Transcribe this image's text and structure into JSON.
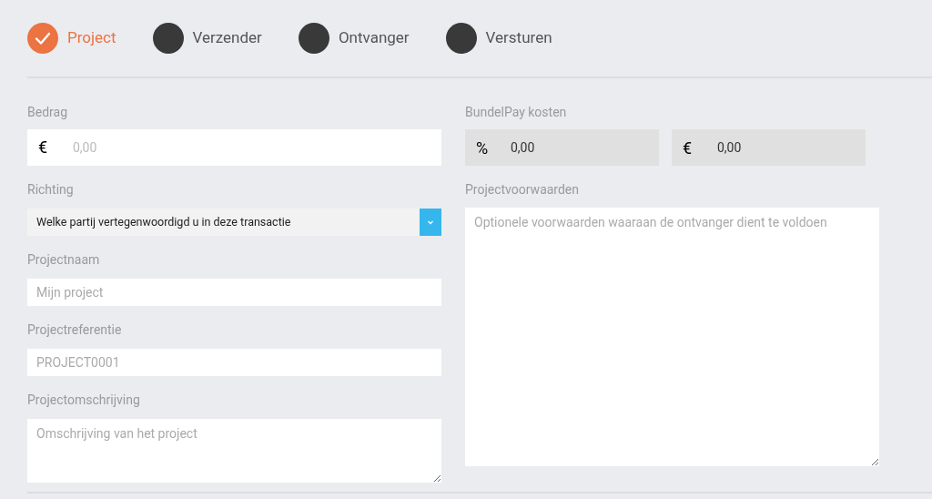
{
  "steps": [
    {
      "label": "Project",
      "done": true
    },
    {
      "label": "Verzender",
      "done": false
    },
    {
      "label": "Ontvanger",
      "done": false
    },
    {
      "label": "Versturen",
      "done": false
    }
  ],
  "amount": {
    "label": "Bedrag",
    "prefix": "€",
    "placeholder": "0,00"
  },
  "direction": {
    "label": "Richting",
    "value": "Welke partij vertegenwoordigd u in deze transactie"
  },
  "project_name": {
    "label": "Projectnaam",
    "placeholder": "Mijn project"
  },
  "project_reference": {
    "label": "Projectreferentie",
    "placeholder": "PROJECT0001"
  },
  "project_description": {
    "label": "Projectomschrijving",
    "placeholder": "Omschrijving van het project"
  },
  "fees": {
    "label": "BundelPay kosten",
    "fields": [
      {
        "prefix": "%",
        "value": "0,00"
      },
      {
        "prefix": "€",
        "value": "0,00"
      }
    ]
  },
  "project_terms": {
    "label": "Projectvoorwaarden",
    "placeholder": "Optionele voorwaarden waaraan de ontvanger dient te voldoen"
  }
}
